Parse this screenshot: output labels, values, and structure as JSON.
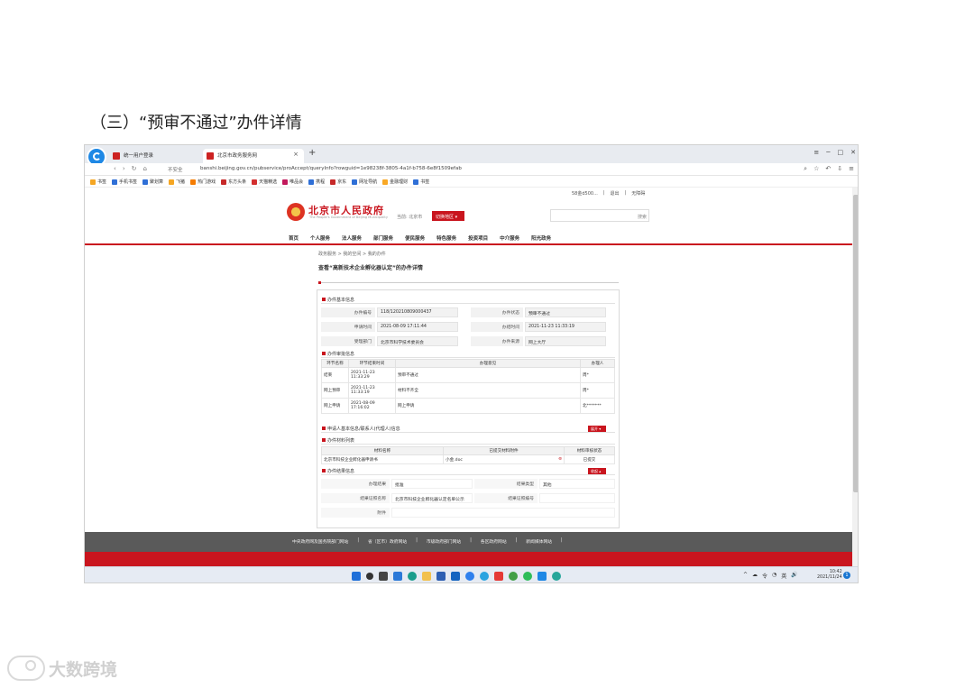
{
  "doc_heading": "（三）“预审不通过”办件详情",
  "browser": {
    "tabs": [
      {
        "label": "统一用户登录"
      },
      {
        "label": "北京市政务服务网"
      }
    ],
    "new_tab": "+",
    "security_label": "不安全",
    "url": "banshi.beijing.gov.cn/pubservice/proAccept/queryInfo?rowguid=1e98238f-3805-4a1f-b758-6e8f1509efab",
    "bookmarks": [
      "书签",
      "手机书签",
      "聚划算",
      "飞猪",
      "热门游戏",
      "东方头条",
      "天猫精选",
      "唯品会",
      "携程",
      "京东",
      "网址导航",
      "金融理财",
      "书签"
    ]
  },
  "site": {
    "user_links": [
      "58金d500...",
      "|",
      "退出",
      "|",
      "无障碍"
    ],
    "title": "北京市人民政府",
    "subtitle": "The People's Government of Beijing Municipality",
    "location_label": "当前: 北京市",
    "location_button": "切换地区 ▾",
    "search_button": "搜索",
    "nav": [
      "首页",
      "个人服务",
      "法人服务",
      "部门服务",
      "便民服务",
      "特色服务",
      "投资项目",
      "中介服务",
      "阳光政务"
    ],
    "breadcrumb": "政务服务 > 我的空间 > 我的办件",
    "detail_title": "查看“高新技术企业孵化器认定”的办件详情"
  },
  "basic": {
    "heading": "办件基本信息",
    "rows": [
      {
        "l1": "办件编号",
        "v1": "118/120210809000437",
        "l2": "办件状态",
        "v2": "预审不通过"
      },
      {
        "l1": "申请时间",
        "v1": "2021-08-09 17:11:44",
        "l2": "办结时间",
        "v2": "2021-11-23 11:33:19"
      },
      {
        "l1": "受理部门",
        "v1": "北京市科学技术委员会",
        "l2": "办件来源",
        "v2": "网上大厅"
      }
    ]
  },
  "review": {
    "heading": "办件审批信息",
    "headers": [
      "环节名称",
      "环节结束时间",
      "办理意见",
      "办理人"
    ],
    "rows": [
      {
        "step": "结束",
        "time": "2021-11-23 11:33:29",
        "opinion": "预审不通过",
        "person": "周*"
      },
      {
        "step": "网上预审",
        "time": "2021-11-23 11:33:19",
        "opinion": "材料不齐全",
        "person": "周*"
      },
      {
        "step": "网上申请",
        "time": "2021-08-09 17:16:02",
        "opinion": "网上申请",
        "person": "北*******"
      }
    ]
  },
  "applicant": {
    "heading": "申请人基本信息/联系人(代理人)信息",
    "toggle": "展开 ▾"
  },
  "materials": {
    "heading": "办件材料列表",
    "headers": [
      "材料名称",
      "已提交材料附件",
      "材料审核状态"
    ],
    "rows": [
      {
        "name": "北京市科技企业孵化器申请书",
        "file": "小金.doc",
        "status": "已提交"
      }
    ]
  },
  "result": {
    "heading": "办件结果信息",
    "toggle": "收起 ▴",
    "rows": [
      {
        "l1": "办理结果",
        "v1": "批准",
        "l2": "结果类型",
        "v2": "其他"
      },
      {
        "l1": "结果证照名称",
        "v1": "北京市科技企业孵化器认定名单公示",
        "l2": "结果证照编号",
        "v2": ""
      },
      {
        "l1": "附件",
        "v1": ""
      }
    ]
  },
  "footer": {
    "links": [
      "中央政府网及国务院部门网站",
      "|",
      "省（区市）政府网站",
      "|",
      "市级政府部门网站",
      "|",
      "各区政府网站",
      "|",
      "新闻媒体网站",
      "|"
    ]
  },
  "taskbar": {
    "tray": [
      "^",
      "☁",
      "令",
      "◔",
      "英",
      "🔊"
    ],
    "time": "10:42",
    "date": "2021/11/24",
    "notifications": "1"
  },
  "watermark_text": "大数跨境",
  "colors": {
    "brand_red": "#c9151e",
    "footer_gray": "#5a5a5a"
  }
}
